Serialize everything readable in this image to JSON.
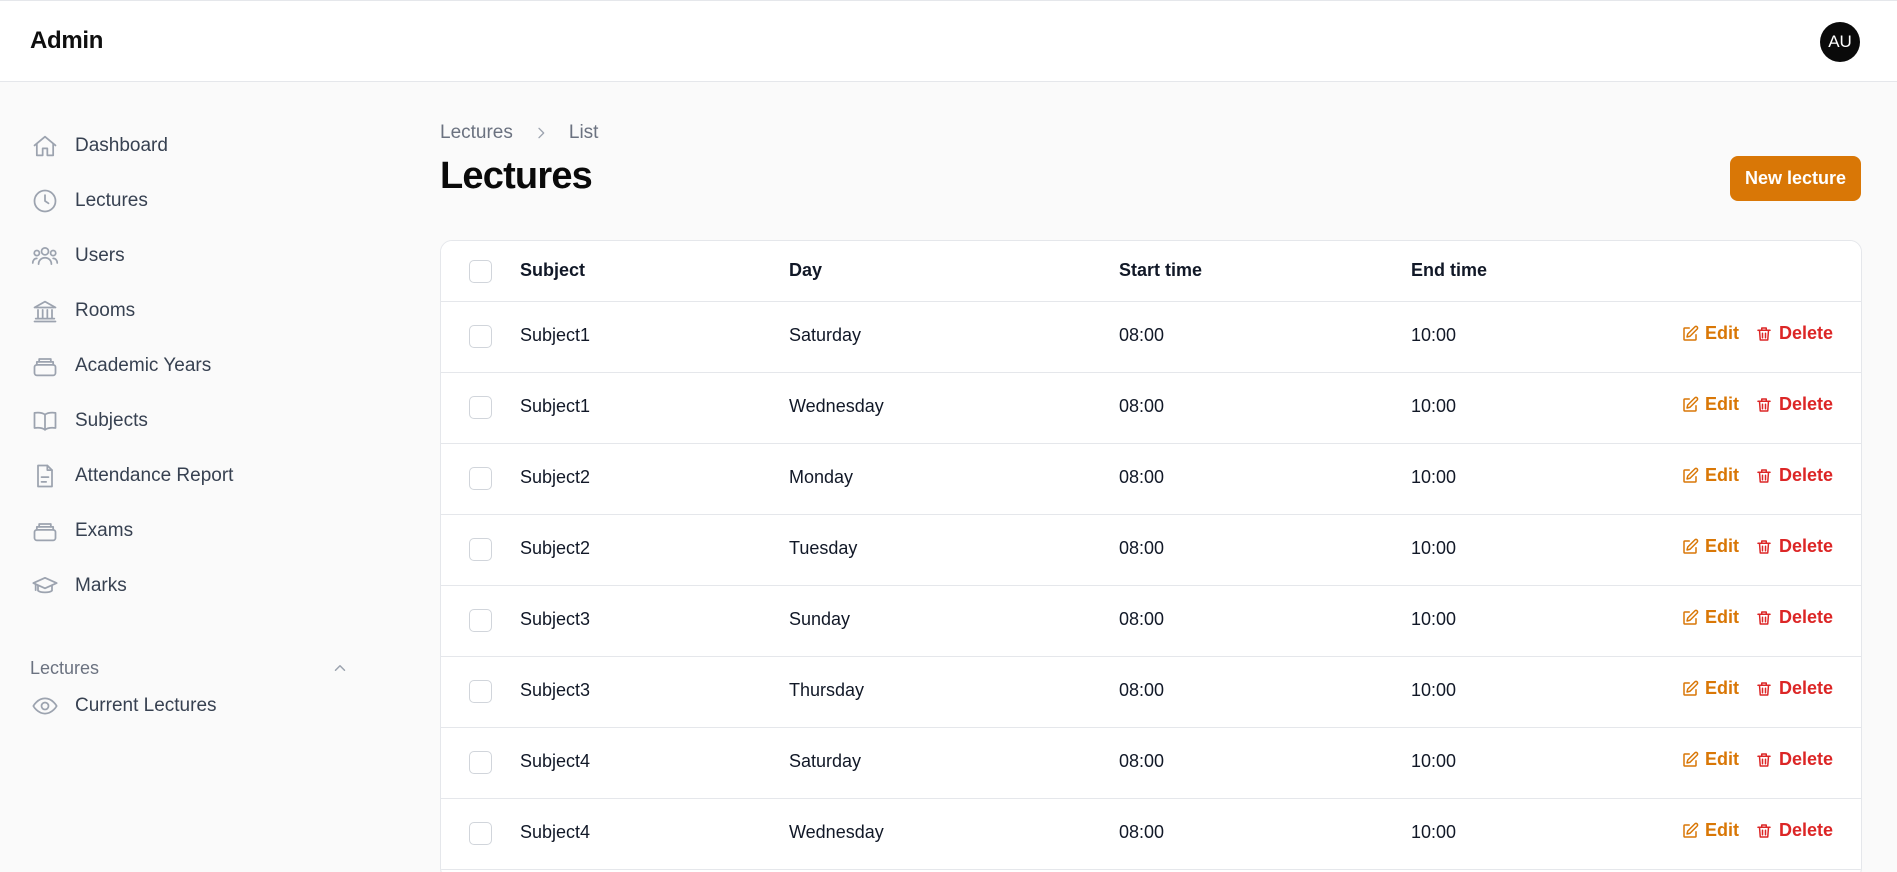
{
  "header": {
    "brand": "Admin",
    "avatar_initials": "AU"
  },
  "sidebar": {
    "items": [
      {
        "label": "Dashboard",
        "icon": "home-icon"
      },
      {
        "label": "Lectures",
        "icon": "clock-icon"
      },
      {
        "label": "Users",
        "icon": "users-icon"
      },
      {
        "label": "Rooms",
        "icon": "building-icon"
      },
      {
        "label": "Academic Years",
        "icon": "stack-icon"
      },
      {
        "label": "Subjects",
        "icon": "book-open-icon"
      },
      {
        "label": "Attendance Report",
        "icon": "document-text-icon"
      },
      {
        "label": "Exams",
        "icon": "stack-icon"
      },
      {
        "label": "Marks",
        "icon": "academic-cap-icon"
      }
    ],
    "group": {
      "label": "Lectures",
      "expanded": true,
      "items": [
        {
          "label": "Current Lectures",
          "icon": "eye-icon"
        }
      ]
    }
  },
  "breadcrumb": {
    "items": [
      "Lectures",
      "List"
    ]
  },
  "page": {
    "title": "Lectures",
    "new_button": "New lecture"
  },
  "table": {
    "columns": [
      "Subject",
      "Day",
      "Start time",
      "End time"
    ],
    "action_labels": {
      "edit": "Edit",
      "delete": "Delete"
    },
    "rows": [
      {
        "subject": "Subject1",
        "day": "Saturday",
        "start": "08:00",
        "end": "10:00"
      },
      {
        "subject": "Subject1",
        "day": "Wednesday",
        "start": "08:00",
        "end": "10:00"
      },
      {
        "subject": "Subject2",
        "day": "Monday",
        "start": "08:00",
        "end": "10:00"
      },
      {
        "subject": "Subject2",
        "day": "Tuesday",
        "start": "08:00",
        "end": "10:00"
      },
      {
        "subject": "Subject3",
        "day": "Sunday",
        "start": "08:00",
        "end": "10:00"
      },
      {
        "subject": "Subject3",
        "day": "Thursday",
        "start": "08:00",
        "end": "10:00"
      },
      {
        "subject": "Subject4",
        "day": "Saturday",
        "start": "08:00",
        "end": "10:00"
      },
      {
        "subject": "Subject4",
        "day": "Wednesday",
        "start": "08:00",
        "end": "10:00"
      }
    ]
  },
  "colors": {
    "accent": "#d97706",
    "danger": "#dc2626",
    "text": "#111827",
    "muted": "#6b7280",
    "border": "#e5e7eb",
    "background": "#fafafa"
  }
}
